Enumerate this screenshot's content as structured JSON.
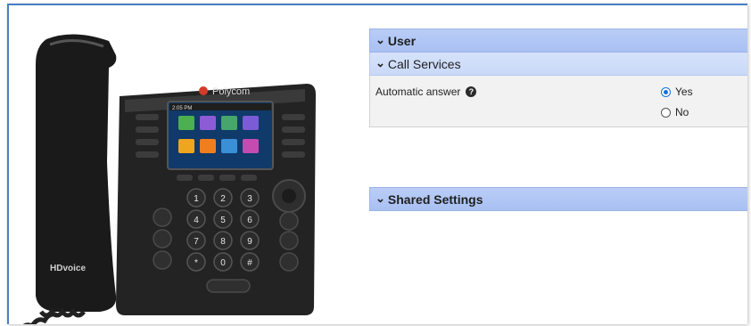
{
  "user_section": {
    "label": "User"
  },
  "call_services": {
    "label": "Call Services"
  },
  "setting": {
    "label": "Automatic answer",
    "options": [
      {
        "label": "Yes",
        "checked": true
      },
      {
        "label": "No",
        "checked": false
      }
    ]
  },
  "shared_section": {
    "label": "Shared Settings"
  },
  "phone": {
    "brand": "Polycom",
    "badge": "HDvoice",
    "screen_time": "2:05 PM",
    "keypad": [
      "1",
      "2",
      "3",
      "4",
      "5",
      "6",
      "7",
      "8",
      "9",
      "*",
      "0",
      "#"
    ]
  },
  "colors": {
    "header": "#b9cdf6",
    "subheader": "#d6e2fb",
    "radio": "#1a6fd6"
  }
}
